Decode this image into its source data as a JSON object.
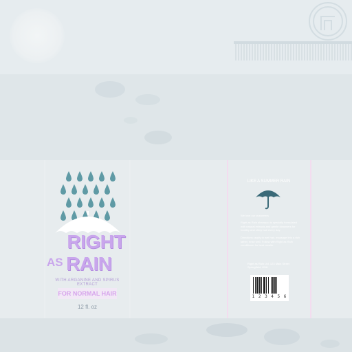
{
  "front": {
    "brand_line1": "RIGHT",
    "brand_as": "AS",
    "brand_rain": "RAIN",
    "tagline": "WITH ARGANINE AND SPIRUS EXTRACT",
    "hair_type": "FOR NORMAL HAIR",
    "volume": "12 fl. oz"
  },
  "back": {
    "heading": "LIKE A SUMMER RAIN",
    "paragraph1": "We love our customers",
    "paragraph2": "Right as Rain shampoo is specially formulated with natural extracts and gentle cleansers for healthy and shiny hair every day.",
    "paragraph3": "Directions: apply to wet hair, massage into a rich lather, rinse well. Follow with Right as Rain conditioner for best results.",
    "address": "Right as Rain Ltd. 123 Main Street Springfield, USA",
    "barcode_number": "1 2 3 4 5 6"
  },
  "colors": {
    "brand_lilac": "#c9a6ec",
    "drop_teal": "#5f9aa5",
    "umbrella_dark": "#3a6a78",
    "panel_line": "#f3dcef"
  },
  "icons": {
    "logo": "circular-emblem-icon",
    "drops": "raindrops-icon",
    "umbrella": "umbrella-icon"
  }
}
